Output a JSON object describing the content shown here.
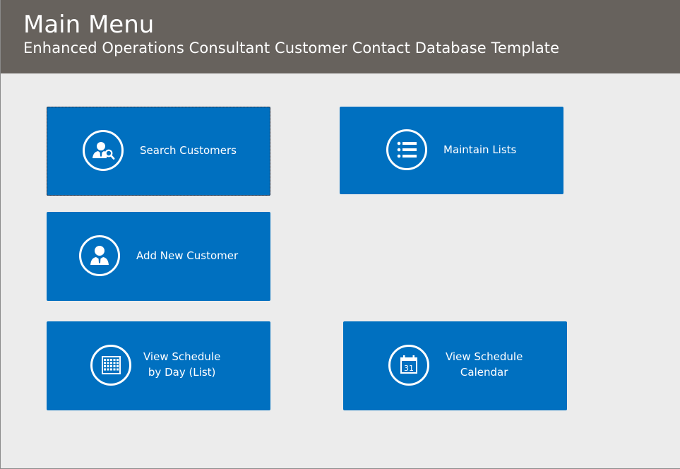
{
  "header": {
    "title": "Main Menu",
    "subtitle": "Enhanced Operations Consultant Customer Contact Database Template"
  },
  "tiles": {
    "search_customers": {
      "label": "Search Customers",
      "icon": "person-search-icon"
    },
    "maintain_lists": {
      "label": "Maintain Lists",
      "icon": "list-icon"
    },
    "add_new_customer": {
      "label": "Add New Customer",
      "icon": "person-icon"
    },
    "view_schedule_day": {
      "line1": "View Schedule",
      "line2": "by Day (List)",
      "icon": "calendar-grid-icon"
    },
    "view_schedule_calendar": {
      "line1": "View Schedule",
      "line2": "Calendar",
      "icon": "calendar-31-icon"
    }
  },
  "colors": {
    "header_bg": "#67625d",
    "tile_bg": "#0070c0",
    "page_bg": "#ececec",
    "text": "#ffffff"
  }
}
